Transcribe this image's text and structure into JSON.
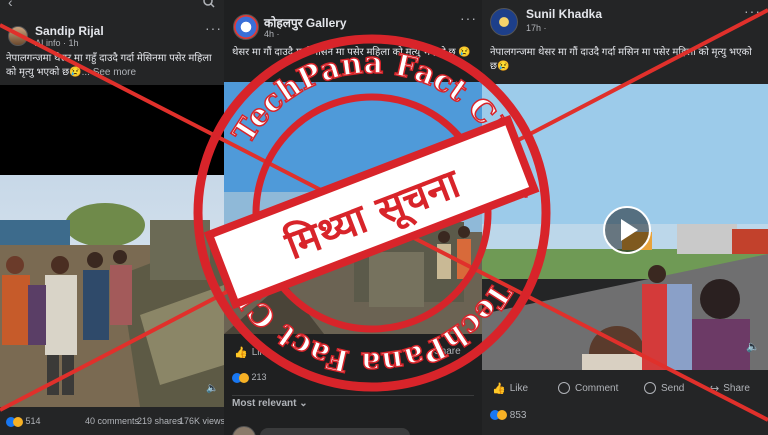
{
  "posts": [
    {
      "author": "Sandip Rijal",
      "subtitle": "AI info · 1h",
      "caption": "नेपालगन्जमा थेसर मा गहुँ दाउदै  गर्दा मेसिनमा पसेर महिला को मृत्यु भएको छ😢",
      "see_more": "... See more",
      "reaction_count": "514",
      "comments": "40 comments",
      "shares": "219 shares",
      "views": "176K views"
    },
    {
      "author": "कोहलपुर Gallery",
      "subtitle": "4h ·",
      "caption": "थेसर मा गौं दाउदै  गर्दा मसिन मा पसेर महिला को मृत्यु भएको छ 😢",
      "reaction_count": "213",
      "like": "Like",
      "share": "Share",
      "sort_label": "Most relevant"
    },
    {
      "author": "Sunil Khadka",
      "subtitle": "17h ·",
      "caption": "नेपालगन्जमा थेसर मा गौं दाउदै  गर्दा मसिन मा पसेर महिला को मृत्यु भएको छ😢",
      "like": "Like",
      "comment": "Comment",
      "send": "Send",
      "share": "Share",
      "reaction_count": "853"
    }
  ],
  "stamp": {
    "ring_text": "TechPana Fact Check",
    "verdict": "मिथ्या सूचना"
  },
  "colors": {
    "cross": "#e0302b",
    "stamp_red": "#d8242a",
    "fb_dark": "#242526",
    "like_blue": "#1877f2"
  }
}
